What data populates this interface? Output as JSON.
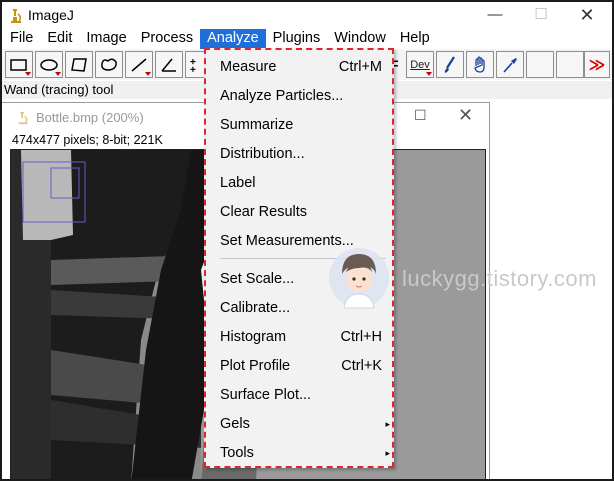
{
  "window": {
    "title": "ImageJ",
    "minimize": "—",
    "maximize": "☐",
    "close": "✕"
  },
  "menubar": {
    "items": [
      {
        "label": "File"
      },
      {
        "label": "Edit"
      },
      {
        "label": "Image"
      },
      {
        "label": "Process"
      },
      {
        "label": "Analyze"
      },
      {
        "label": "Plugins"
      },
      {
        "label": "Window"
      },
      {
        "label": "Help"
      }
    ]
  },
  "toolbar": {
    "tools": [
      "rectangle-tool",
      "oval-tool",
      "polygon-tool",
      "freehand-tool",
      "line-tool",
      "angle-tool",
      "point-tool",
      "wand-tool",
      "text-tool",
      "magnifier-tool",
      "scroll-tool",
      "dev-menu",
      "brush-tool",
      "flood-fill-tool",
      "pick-color-tool",
      "more-tools"
    ],
    "dev_label": "Dev",
    "more_label": "≫"
  },
  "status": {
    "text": "Wand (tracing) tool"
  },
  "image_window": {
    "title": "Bottle.bmp (200%)",
    "info": "474x477 pixels; 8-bit; 221K",
    "maximize": "☐",
    "close": "✕"
  },
  "analyze_menu": {
    "items": [
      {
        "label": "Measure",
        "shortcut": "Ctrl+M"
      },
      {
        "label": "Analyze Particles...",
        "shortcut": ""
      },
      {
        "label": "Summarize",
        "shortcut": ""
      },
      {
        "label": "Distribution...",
        "shortcut": ""
      },
      {
        "label": "Label",
        "shortcut": ""
      },
      {
        "label": "Clear Results",
        "shortcut": ""
      },
      {
        "label": "Set Measurements...",
        "shortcut": ""
      },
      {
        "label": "Set Scale...",
        "shortcut": ""
      },
      {
        "label": "Calibrate...",
        "shortcut": ""
      },
      {
        "label": "Histogram",
        "shortcut": "Ctrl+H"
      },
      {
        "label": "Plot Profile",
        "shortcut": "Ctrl+K"
      },
      {
        "label": "Surface Plot...",
        "shortcut": ""
      },
      {
        "label": "Gels",
        "shortcut": "",
        "submenu": "▸"
      },
      {
        "label": "Tools",
        "shortcut": "",
        "submenu": "▸"
      }
    ]
  },
  "watermark": {
    "text": "luckygg.tistory.com"
  },
  "colors": {
    "menu_highlight": "#1e6fd9",
    "dashed_outline": "#e0262c"
  }
}
